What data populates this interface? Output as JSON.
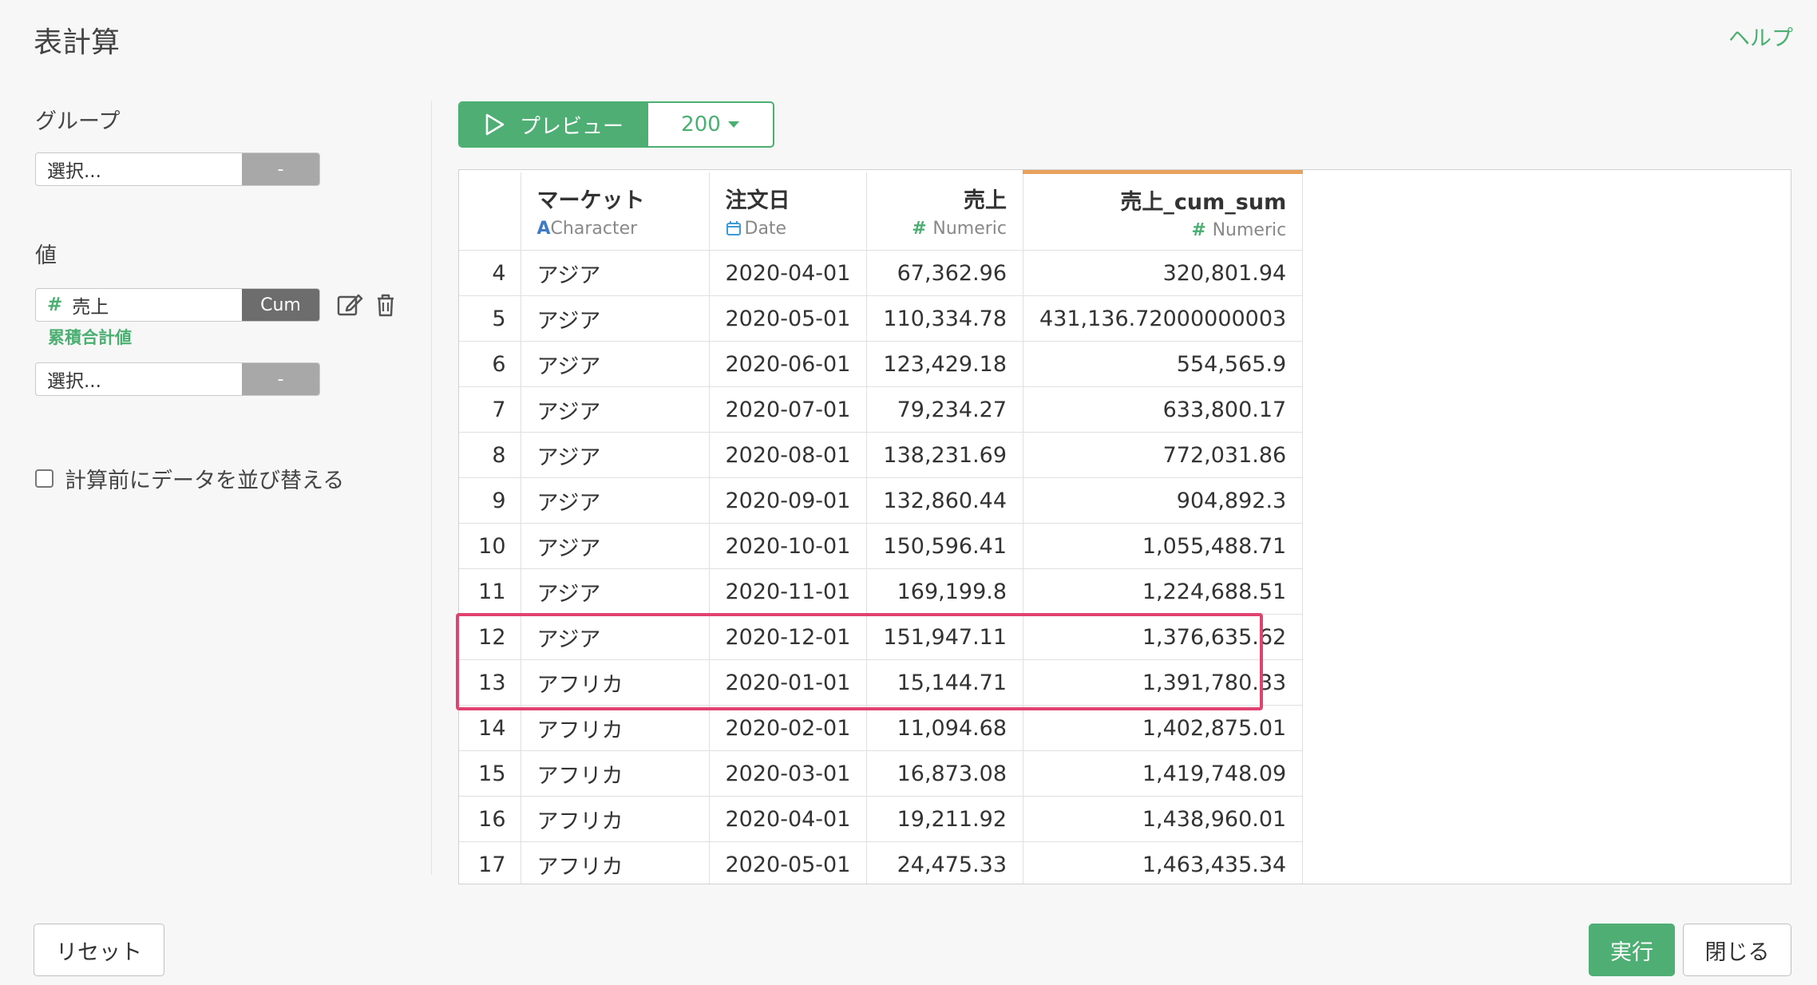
{
  "title": "表計算",
  "help_label": "ヘルプ",
  "group": {
    "label": "グループ",
    "select_placeholder": "選択...",
    "remove_label": "-"
  },
  "value": {
    "label": "値",
    "field": {
      "name": "売上",
      "func": "Cum",
      "sub_label": "累積合計値"
    },
    "select_placeholder": "選択...",
    "remove_label": "-"
  },
  "sort_checkbox_label": "計算前にデータを並び替える",
  "preview": {
    "label": "プレビュー",
    "count": "200"
  },
  "table": {
    "columns": [
      {
        "name": "マーケット",
        "type": "Character"
      },
      {
        "name": "注文日",
        "type": "Date"
      },
      {
        "name": "売上",
        "type": "Numeric"
      },
      {
        "name": "売上_cum_sum",
        "type": "Numeric"
      }
    ],
    "rows": [
      [
        "4",
        "アジア",
        "2020-04-01",
        "67,362.96",
        "320,801.94"
      ],
      [
        "5",
        "アジア",
        "2020-05-01",
        "110,334.78",
        "431,136.72000000003"
      ],
      [
        "6",
        "アジア",
        "2020-06-01",
        "123,429.18",
        "554,565.9"
      ],
      [
        "7",
        "アジア",
        "2020-07-01",
        "79,234.27",
        "633,800.17"
      ],
      [
        "8",
        "アジア",
        "2020-08-01",
        "138,231.69",
        "772,031.86"
      ],
      [
        "9",
        "アジア",
        "2020-09-01",
        "132,860.44",
        "904,892.3"
      ],
      [
        "10",
        "アジア",
        "2020-10-01",
        "150,596.41",
        "1,055,488.71"
      ],
      [
        "11",
        "アジア",
        "2020-11-01",
        "169,199.8",
        "1,224,688.51"
      ],
      [
        "12",
        "アジア",
        "2020-12-01",
        "151,947.11",
        "1,376,635.62"
      ],
      [
        "13",
        "アフリカ",
        "2020-01-01",
        "15,144.71",
        "1,391,780.33"
      ],
      [
        "14",
        "アフリカ",
        "2020-02-01",
        "11,094.68",
        "1,402,875.01"
      ],
      [
        "15",
        "アフリカ",
        "2020-03-01",
        "16,873.08",
        "1,419,748.09"
      ],
      [
        "16",
        "アフリカ",
        "2020-04-01",
        "19,211.92",
        "1,438,960.01"
      ],
      [
        "17",
        "アフリカ",
        "2020-05-01",
        "24,475.33",
        "1,463,435.34"
      ]
    ]
  },
  "footer": {
    "reset_label": "リセット",
    "run_label": "実行",
    "close_label": "閉じる"
  },
  "colors": {
    "accent": "#4fae73",
    "highlight": "#e04370",
    "column_accent": "#e8a25b"
  }
}
